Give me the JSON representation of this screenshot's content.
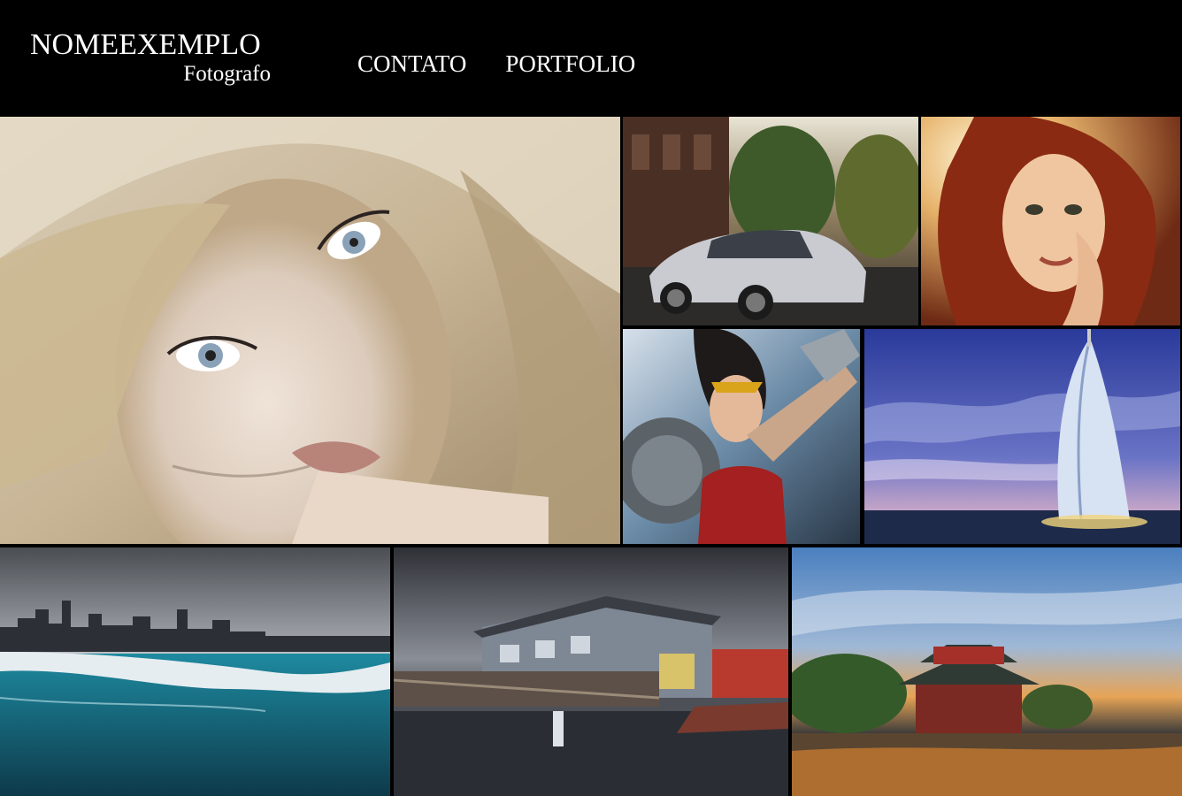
{
  "brand": {
    "name": "NOMEEXEMPLO",
    "subtitle": "Fotografo"
  },
  "nav": {
    "items": [
      {
        "label": "CONTATO"
      },
      {
        "label": "PORTFOLIO"
      }
    ]
  },
  "gallery": {
    "background": "#000000",
    "photos": [
      {
        "subject": "blonde-woman-portrait"
      },
      {
        "subject": "silver-sports-car-street"
      },
      {
        "subject": "red-hair-woman-portrait"
      },
      {
        "subject": "wonder-woman-illustration"
      },
      {
        "subject": "sail-hotel-tower-dusk"
      },
      {
        "subject": "frozen-lake-city-skyline"
      },
      {
        "subject": "waterfront-houses-stormy-sky"
      },
      {
        "subject": "pagoda-sunset-river"
      }
    ]
  }
}
